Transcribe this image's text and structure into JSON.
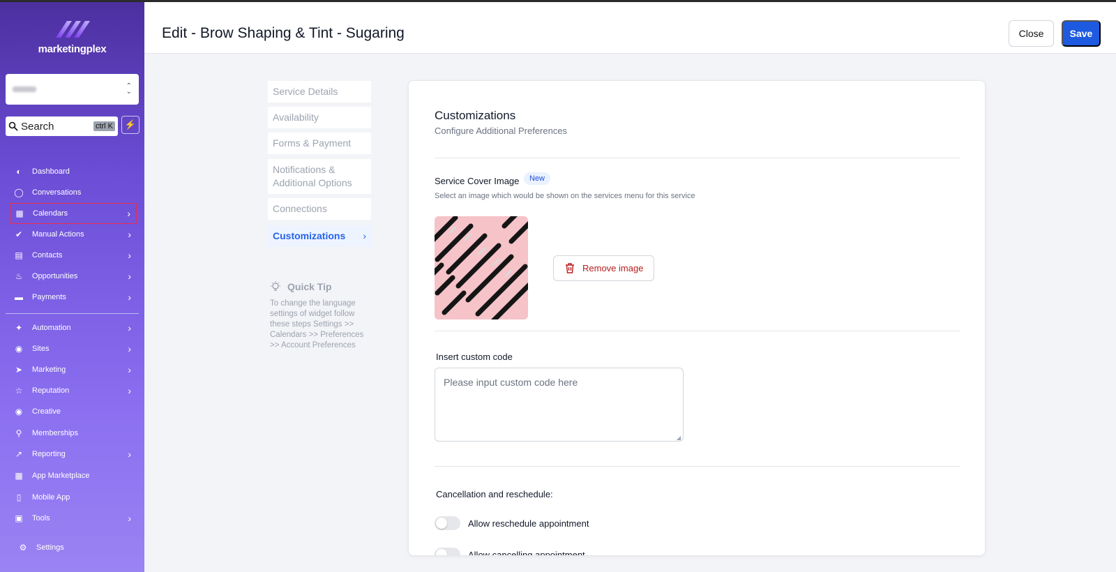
{
  "brand": {
    "name": "marketingplex"
  },
  "sidebar": {
    "search": {
      "placeholder": "Search",
      "shortcut": "ctrl K"
    },
    "items": [
      {
        "label": "Dashboard",
        "icon": "dashboard-icon",
        "chevron": false
      },
      {
        "label": "Conversations",
        "icon": "chat-icon",
        "chevron": false
      },
      {
        "label": "Calendars",
        "icon": "calendar-icon",
        "chevron": true
      },
      {
        "label": "Manual Actions",
        "icon": "check-circle-icon",
        "chevron": true
      },
      {
        "label": "Contacts",
        "icon": "contacts-icon",
        "chevron": true
      },
      {
        "label": "Opportunities",
        "icon": "flame-icon",
        "chevron": true
      },
      {
        "label": "Payments",
        "icon": "credit-card-icon",
        "chevron": true
      },
      {
        "label": "Automation",
        "icon": "wand-icon",
        "chevron": true
      },
      {
        "label": "Sites",
        "icon": "globe-icon",
        "chevron": true
      },
      {
        "label": "Marketing",
        "icon": "send-icon",
        "chevron": true
      },
      {
        "label": "Reputation",
        "icon": "star-icon",
        "chevron": true
      },
      {
        "label": "Creative",
        "icon": "palette-icon",
        "chevron": false
      },
      {
        "label": "Memberships",
        "icon": "badge-icon",
        "chevron": false
      },
      {
        "label": "Reporting",
        "icon": "chart-icon",
        "chevron": true
      },
      {
        "label": "App Marketplace",
        "icon": "grid-icon",
        "chevron": false
      },
      {
        "label": "Mobile App",
        "icon": "mobile-icon",
        "chevron": false
      },
      {
        "label": "Tools",
        "icon": "toolbox-icon",
        "chevron": true
      }
    ],
    "settings_label": "Settings",
    "highlight_color": "#ef2b4b"
  },
  "header": {
    "title": "Edit - Brow Shaping & Tint - Sugaring",
    "close_label": "Close",
    "save_label": "Save"
  },
  "subnav": {
    "items": [
      {
        "label": "Service Details",
        "active": false
      },
      {
        "label": "Availability",
        "active": false
      },
      {
        "label": "Forms & Payment",
        "active": false
      },
      {
        "label": "Notifications & Additional Options",
        "active": false
      },
      {
        "label": "Connections",
        "active": false
      },
      {
        "label": "Customizations",
        "active": true
      }
    ],
    "quick_tip": {
      "title": "Quick Tip",
      "text": "To change the language settings of widget follow these steps Settings >> Calendars >> Preferences >> Account Preferences"
    }
  },
  "main": {
    "title": "Customizations",
    "subtitle": "Configure Additional Preferences",
    "cover_image": {
      "label": "Service Cover Image",
      "badge": "New",
      "description": "Select an image which would be shown on the services menu for this service",
      "remove_label": "Remove image"
    },
    "custom_code": {
      "label": "Insert custom code",
      "placeholder": "Please input custom code here",
      "value": ""
    },
    "cancellation": {
      "label": "Cancellation and reschedule:",
      "toggles": [
        {
          "label": "Allow reschedule appointment",
          "on": false
        },
        {
          "label": "Allow cancelling appointment",
          "on": false
        }
      ]
    }
  },
  "colors": {
    "primary": "#1d5ae0",
    "danger": "#b91c1c",
    "active_tab": "#2563eb"
  }
}
